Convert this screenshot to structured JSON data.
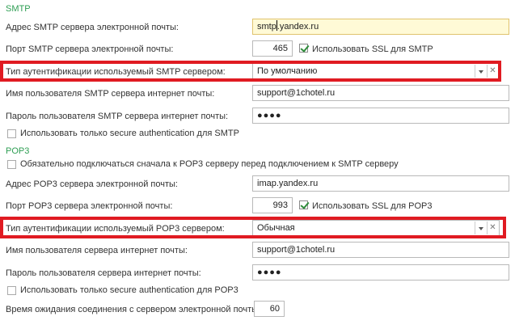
{
  "smtp": {
    "section_title": "SMTP",
    "server_label": "Адрес SMTP сервера электронной почты:",
    "server_value_before_caret": "smtp",
    "server_value_after_caret": ".yandex.ru",
    "port_label": "Порт SMTP сервера электронной почты:",
    "port_value": "465",
    "ssl_label": "Использовать SSL для SMTP",
    "ssl_checked": true,
    "auth_label": "Тип аутентификации используемый SMTP сервером:",
    "auth_value": "По умолчанию",
    "user_label": "Имя пользователя SMTP сервера интернет почты:",
    "user_value": "support@1chotel.ru",
    "password_label": "Пароль пользователя SMTP сервера интернет почты:",
    "password_mask": "●●●●",
    "secure_auth_label": "Использовать только secure authentication для SMTP",
    "secure_auth_checked": false
  },
  "pop3": {
    "section_title": "POP3",
    "connect_first_label": "Обязательно подключаться сначала к POP3 серверу перед подключением к SMTP серверу",
    "connect_first_checked": false,
    "server_label": "Адрес POP3 сервера электронной почты:",
    "server_value": "imap.yandex.ru",
    "port_label": "Порт POP3 сервера электронной почты:",
    "port_value": "993",
    "ssl_label": "Использовать SSL для POP3",
    "ssl_checked": true,
    "auth_label": "Тип аутентификации используемый POP3 сервером:",
    "auth_value": "Обычная",
    "user_label": "Имя пользователя сервера интернет почты:",
    "user_value": "support@1chotel.ru",
    "password_label": "Пароль пользователя сервера интернет почты:",
    "password_mask": "●●●●",
    "secure_auth_label": "Использовать только secure authentication для POP3",
    "secure_auth_checked": false
  },
  "timeout": {
    "label": "Время ожидания соединения с сервером электронной почты:",
    "value": "60"
  },
  "icons": {
    "dropdown": "chevron-down-icon",
    "clear": "close-icon",
    "checkbox": "checkbox-icon"
  },
  "colors": {
    "section_title": "#2e9e53",
    "highlight": "#e01b22",
    "focused_field": "#fffad6"
  }
}
